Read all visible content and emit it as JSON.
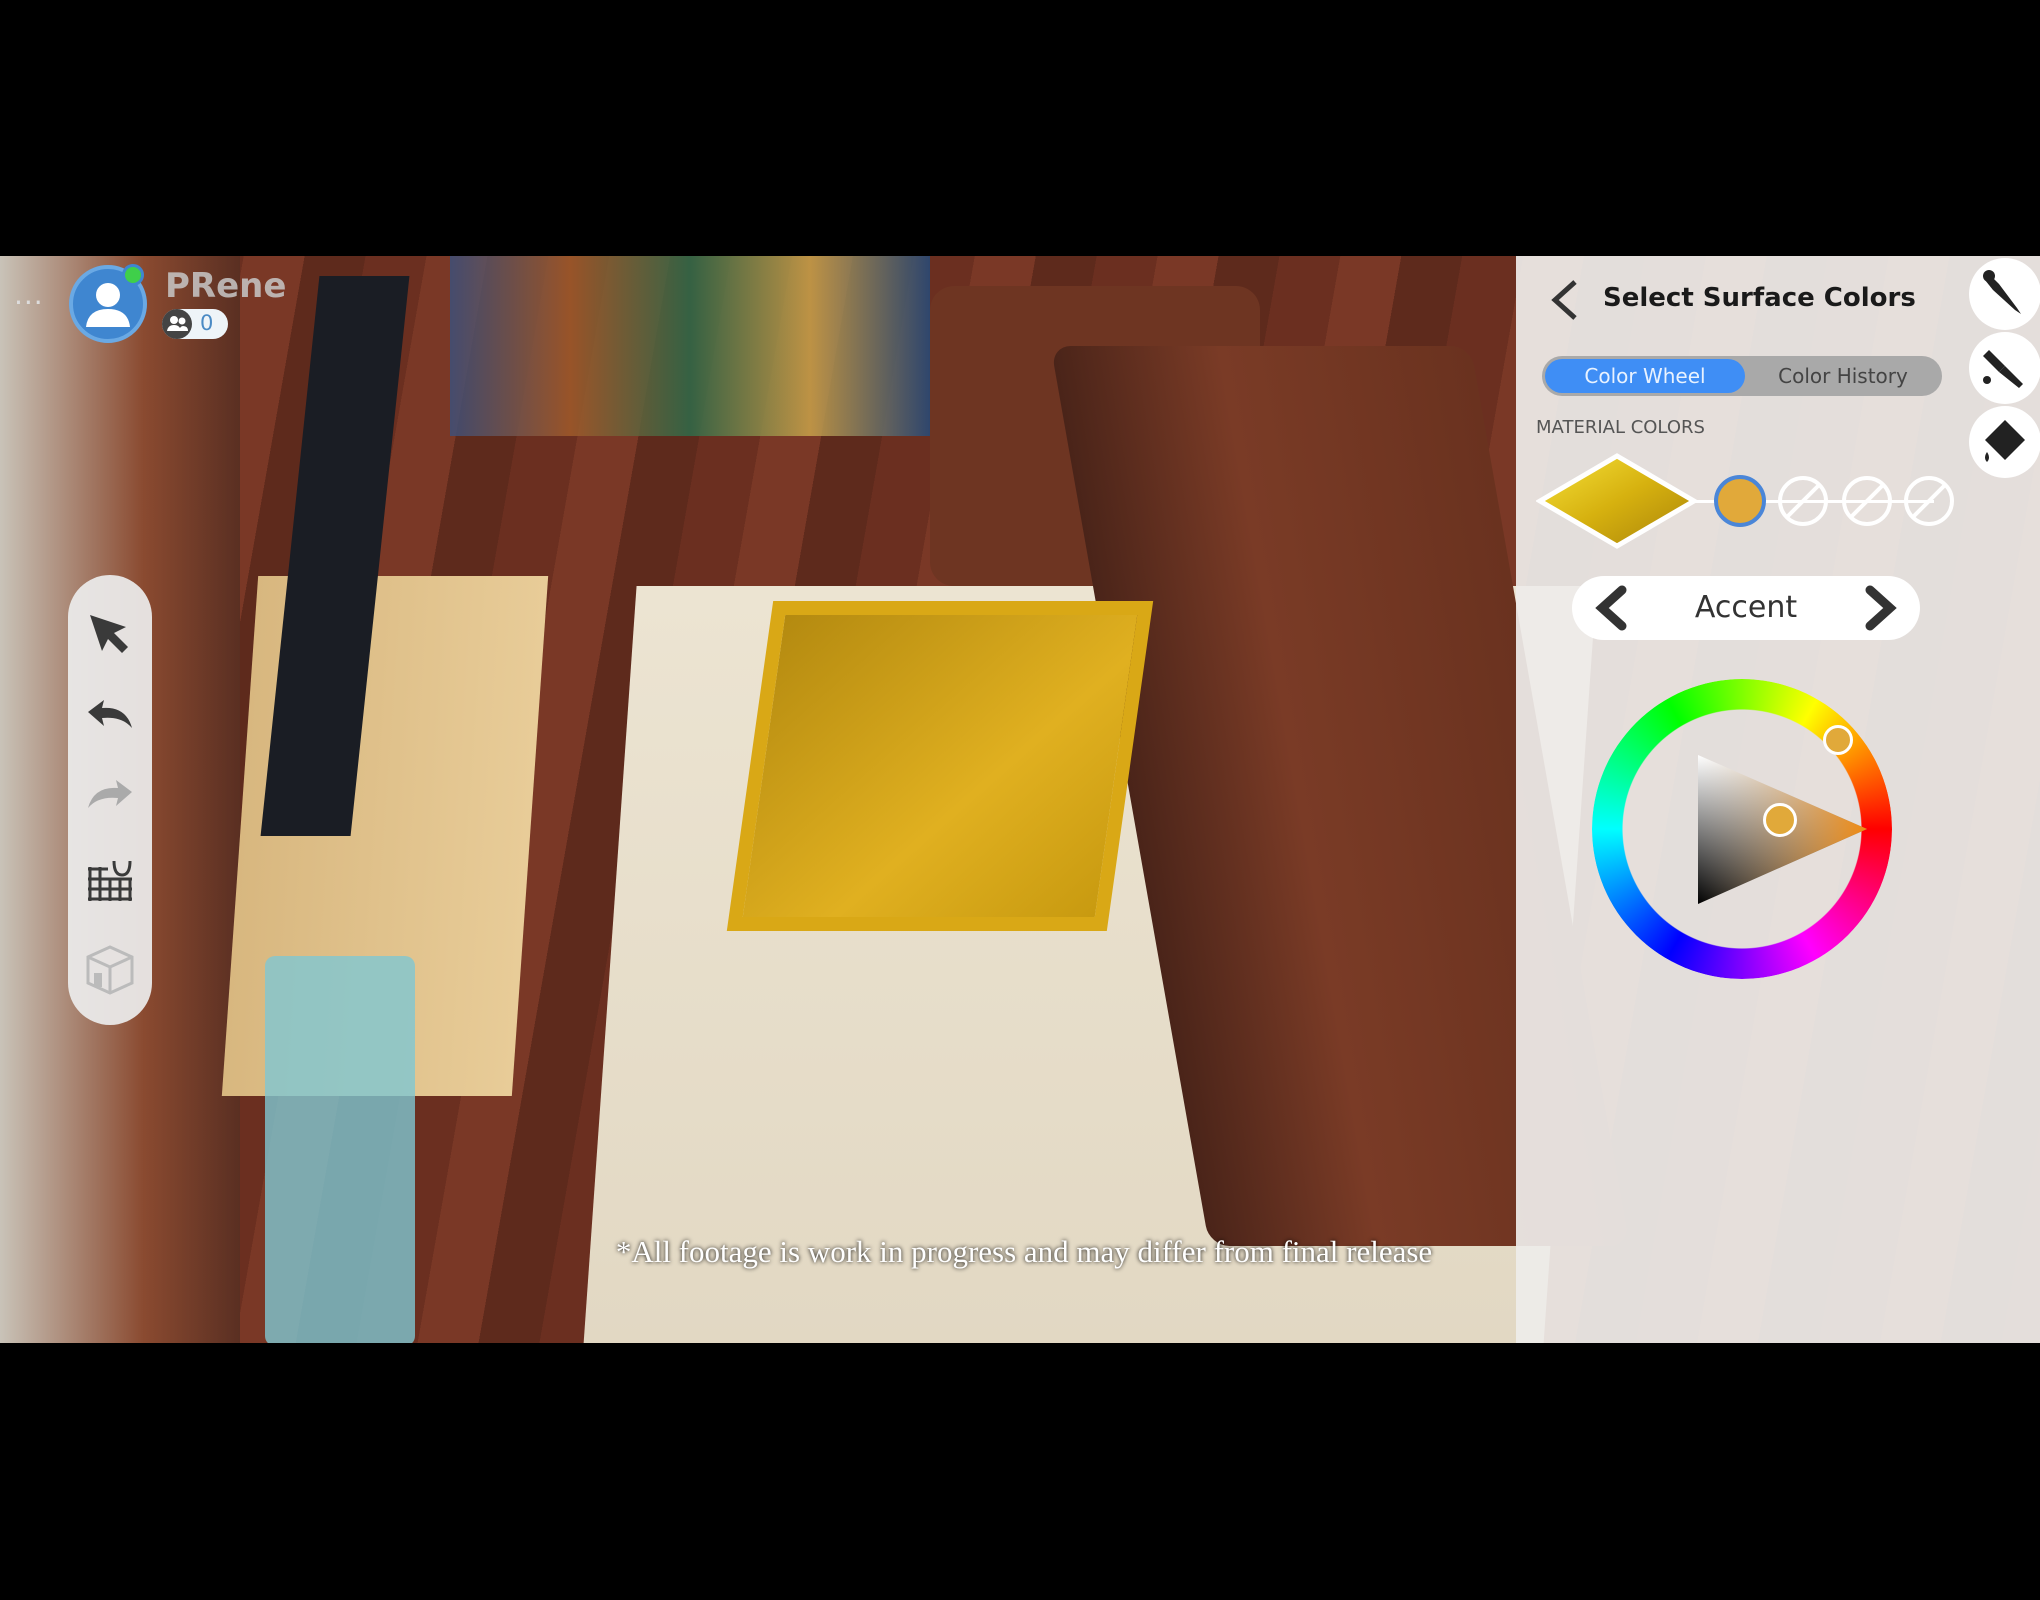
{
  "disclaimer": "*All footage is work in progress and may differ from final release",
  "hud": {
    "menu_label": "...",
    "player_name": "PRene",
    "friends_count": "0",
    "online_status_color": "#3fcf4a"
  },
  "toolbar": {
    "tools": [
      {
        "icon": "select-arrow-icon",
        "enabled": true
      },
      {
        "icon": "undo-icon",
        "enabled": true
      },
      {
        "icon": "redo-icon",
        "enabled": false
      },
      {
        "icon": "grid-snap-magnet-icon",
        "enabled": true
      },
      {
        "icon": "room-cube-icon",
        "enabled": false
      }
    ]
  },
  "panel": {
    "title": "Select Surface Colors",
    "tabs": [
      {
        "label": "Color Wheel",
        "active": true
      },
      {
        "label": "Color History",
        "active": false
      }
    ],
    "material_colors_label": "MATERIAL COLORS",
    "material_swatch_color": "#e3c21a",
    "color_slots": [
      {
        "color": "#e1a93a",
        "selected": true
      },
      {
        "color": null
      },
      {
        "color": null
      },
      {
        "color": null
      }
    ],
    "channel_selector": {
      "value": "Accent"
    },
    "side_tools": [
      {
        "icon": "eyedropper-icon"
      },
      {
        "icon": "paint-brush-icon"
      },
      {
        "icon": "paint-bucket-icon"
      }
    ],
    "color_wheel": {
      "selected_color": "#e1a93a",
      "accent_color": "#3f8ef5"
    }
  }
}
